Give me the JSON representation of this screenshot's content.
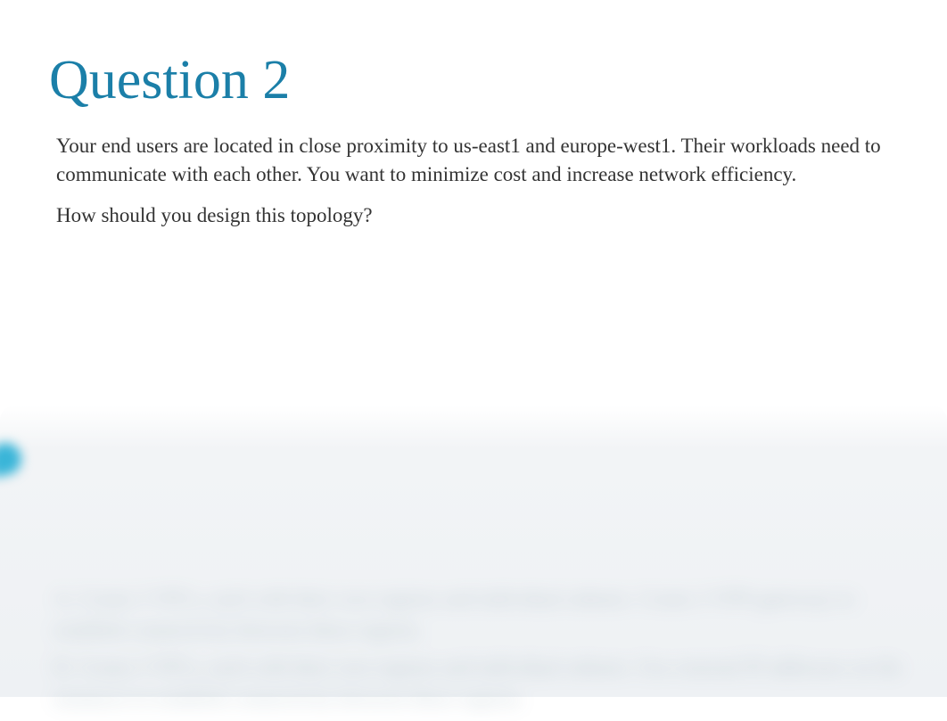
{
  "question": {
    "title": "Question 2",
    "text": "Your end users are located in close proximity to us-east1 and europe-west1. Their workloads need to communicate with each other. You want to minimize cost and increase network efficiency.",
    "prompt": "How should you design this topology?"
  },
  "blurred_answers": {
    "line_a": "A. Create 2 VPCs, each with their own regions and individual subnets. Create 2 VPN gateways to establish connectivity between these regions.",
    "line_b": "B. Create 2 VPCs, each with their own regions and individual subnets. Use external IP addresses on the instances to establish connectivity between these regions."
  }
}
